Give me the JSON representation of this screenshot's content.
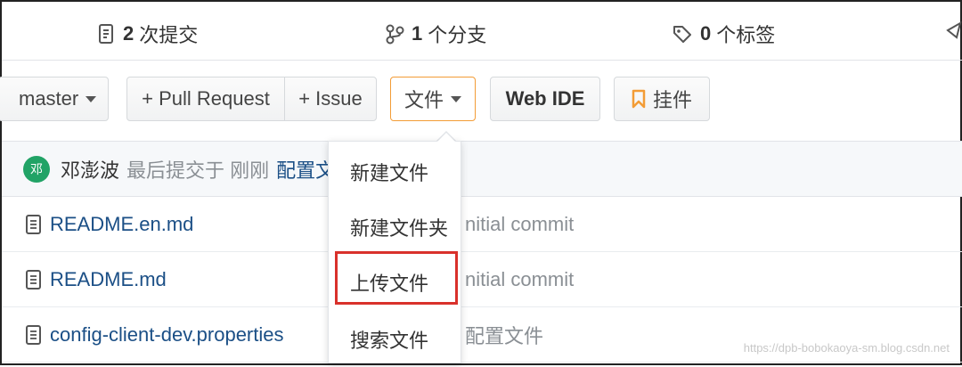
{
  "stats": {
    "commits": {
      "count": "2",
      "label": "次提交"
    },
    "branches": {
      "count": "1",
      "label": "个分支"
    },
    "tags": {
      "count": "0",
      "label": "个标签"
    }
  },
  "toolbar": {
    "branch": "master",
    "pull_request": "+ Pull Request",
    "issue": "+ Issue",
    "file_menu": "文件",
    "web_ide": "Web IDE",
    "widget": "挂件"
  },
  "commit": {
    "avatar_text": "邓",
    "author": "邓澎波",
    "meta": "最后提交于 刚刚",
    "message": "配置文"
  },
  "files": [
    {
      "name": "README.en.md",
      "message": "nitial commit"
    },
    {
      "name": "README.md",
      "message": "nitial commit"
    },
    {
      "name": "config-client-dev.properties",
      "message": "配置文件"
    }
  ],
  "dropdown": {
    "items": [
      "新建文件",
      "新建文件夹",
      "上传文件",
      "搜索文件"
    ]
  },
  "watermark": "https://dpb-bobokaoya-sm.blog.csdn.net",
  "colors": {
    "accent_orange": "#f39c36",
    "highlight_red": "#d9312b",
    "link_blue": "#1b4f86"
  }
}
